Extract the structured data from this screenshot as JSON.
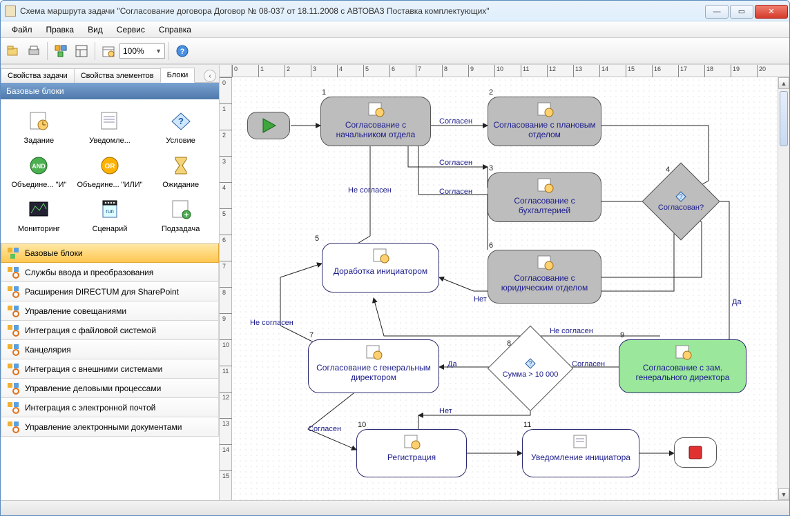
{
  "window": {
    "title": "Схема маршрута задачи \"Согласование договора Договор № 08-037 от 18.11.2008 с АВТОВАЗ Поставка комплектующих\""
  },
  "menu": {
    "items": [
      "Файл",
      "Правка",
      "Вид",
      "Сервис",
      "Справка"
    ]
  },
  "toolbar": {
    "zoom": "100%"
  },
  "tabs": {
    "items": [
      "Свойства задачи",
      "Свойства элементов",
      "Блоки"
    ],
    "active": 2
  },
  "section_header": "Базовые блоки",
  "palette": [
    {
      "label": "Задание",
      "icon": "task"
    },
    {
      "label": "Уведомле...",
      "icon": "task"
    },
    {
      "label": "Условие",
      "icon": "cond"
    },
    {
      "label": "Объедине... \"И\"",
      "icon": "and"
    },
    {
      "label": "Объедине... \"ИЛИ\"",
      "icon": "or"
    },
    {
      "label": "Ожидание",
      "icon": "wait"
    },
    {
      "label": "Мониторинг",
      "icon": "monitor"
    },
    {
      "label": "Сценарий",
      "icon": "script"
    },
    {
      "label": "Подзадача",
      "icon": "subtask"
    }
  ],
  "categories": [
    {
      "label": "Базовые блоки",
      "active": true
    },
    {
      "label": "Службы ввода и преобразования"
    },
    {
      "label": "Расширения DIRECTUM для SharePoint"
    },
    {
      "label": "Управление совещаниями"
    },
    {
      "label": "Интеграция с файловой системой"
    },
    {
      "label": "Канцелярия"
    },
    {
      "label": "Интеграция с внешними системами"
    },
    {
      "label": "Управление деловыми процессами"
    },
    {
      "label": "Интеграция с электронной почтой"
    },
    {
      "label": "Управление электронными документами"
    }
  ],
  "ruler_h": [
    "0",
    "1",
    "2",
    "3",
    "4",
    "5",
    "6",
    "7",
    "8",
    "9",
    "10",
    "11",
    "12",
    "13",
    "14",
    "15",
    "16",
    "17",
    "18",
    "19",
    "20"
  ],
  "ruler_v": [
    "0",
    "1",
    "2",
    "3",
    "4",
    "5",
    "6",
    "7",
    "8",
    "9",
    "10",
    "11",
    "12",
    "13",
    "14",
    "15"
  ],
  "nodes": {
    "n1": {
      "num": "1",
      "text": "Согласование с начальником отдела"
    },
    "n2": {
      "num": "2",
      "text": "Согласование с плановым отделом"
    },
    "n3": {
      "num": "3",
      "text": "Согласование с бухгалтерией"
    },
    "n4": {
      "num": "4",
      "text": "Согласован?"
    },
    "n5": {
      "num": "5",
      "text": "Доработка инициатором"
    },
    "n6": {
      "num": "6",
      "text": "Согласование с юридическим отделом"
    },
    "n7": {
      "num": "7",
      "text": "Согласование с генеральным директором"
    },
    "n8": {
      "num": "8",
      "text": "Сумма > 10 000"
    },
    "n9": {
      "num": "9",
      "text": "Согласование с зам. генерального директора"
    },
    "n10": {
      "num": "10",
      "text": "Регистрация"
    },
    "n11": {
      "num": "11",
      "text": "Уведомление инициатора"
    }
  },
  "edge_labels": {
    "e1": "Согласен",
    "e2": "Согласен",
    "e3": "Согласен",
    "e4": "Не согласен",
    "e5": "Нет",
    "e6": "Да",
    "e7": "Не согласен",
    "e8": "Не согласен",
    "e9": "Да",
    "e10": "Согласен",
    "e11": "Нет",
    "e12": "Согласен"
  }
}
